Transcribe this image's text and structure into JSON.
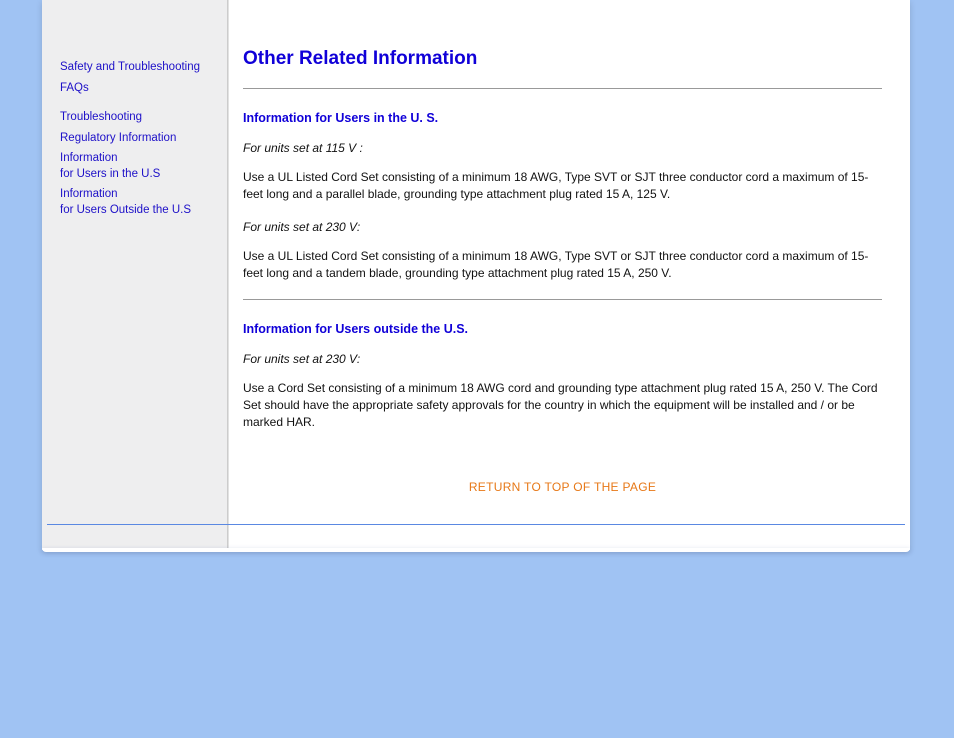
{
  "sidebar": {
    "group1": [
      {
        "label": "Safety and Troubleshooting"
      },
      {
        "label": "FAQs"
      }
    ],
    "group2": [
      {
        "label": "Troubleshooting"
      },
      {
        "label": "Regulatory Information"
      },
      {
        "line1": "Information",
        "line2": "for Users in the U.S"
      },
      {
        "line1": "Information",
        "line2": "for Users Outside the U.S"
      }
    ]
  },
  "main": {
    "title": "Other Related Information",
    "section1": {
      "heading": "Information for Users in the U. S.",
      "sub1": "For units set at 115 V :",
      "para1": "Use a UL Listed Cord Set consisting of a minimum 18 AWG, Type SVT or SJT three conductor cord a maximum of 15-feet long and a parallel blade, grounding type attachment plug rated 15 A, 125 V.",
      "sub2": "For units set at 230 V:",
      "para2": "Use a UL Listed Cord Set consisting of a minimum 18 AWG, Type SVT or SJT three conductor cord a maximum of 15-feet long and a tandem blade, grounding type attachment plug rated 15 A, 250 V."
    },
    "section2": {
      "heading": "Information for Users outside the U.S.",
      "sub1": "For units set at 230 V:",
      "para1": "Use a Cord Set consisting of a minimum 18 AWG cord and grounding type attachment plug rated 15 A, 250 V. The Cord Set should have the appropriate safety approvals for the country in which the equipment will be installed and / or be marked HAR."
    },
    "return_link": "RETURN TO TOP OF THE PAGE"
  }
}
